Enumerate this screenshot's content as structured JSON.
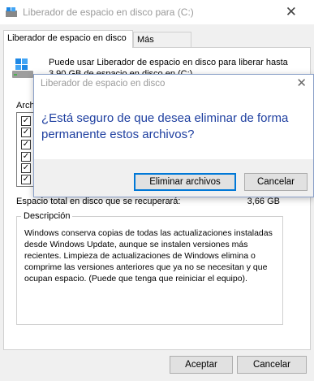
{
  "window": {
    "title": "Liberador de espacio en disco para  (C:)",
    "close_glyph": "✕"
  },
  "tabs": [
    {
      "label": "Liberador de espacio en disco",
      "active": true
    },
    {
      "label": "Más opciones",
      "active": false
    }
  ],
  "intro_text": "Puede usar Liberador de espacio en disco para liberar hasta 3,90 GB de espacio en disco en  (C:).",
  "files_label": "Archi",
  "checkboxes": [
    true,
    true,
    true,
    true,
    true,
    true
  ],
  "total": {
    "label": "Espacio total en disco que se recuperará:",
    "value": "3,66 GB"
  },
  "description": {
    "legend": "Descripción",
    "text": "Windows conserva copias de todas las actualizaciones instaladas desde Windows Update, aunque se instalen versiones más recientes. Limpieza de actualizaciones de Windows elimina o comprime las versiones anteriores que ya no se necesitan y que ocupan espacio. (Puede que tenga que reiniciar el equipo)."
  },
  "buttons": {
    "ok": "Aceptar",
    "cancel": "Cancelar"
  },
  "dialog": {
    "title": "Liberador de espacio en disco",
    "close_glyph": "✕",
    "question": "¿Está seguro de que desea eliminar de forma permanente estos archivos?",
    "delete_label": "Eliminar archivos",
    "cancel_label": "Cancelar"
  },
  "colors": {
    "accent": "#0078d7",
    "question_text": "#1e3fa0",
    "title_text": "#9a9a9a"
  },
  "icons": {
    "app": "disk-cleanup-icon",
    "drive": "drive-icon"
  }
}
